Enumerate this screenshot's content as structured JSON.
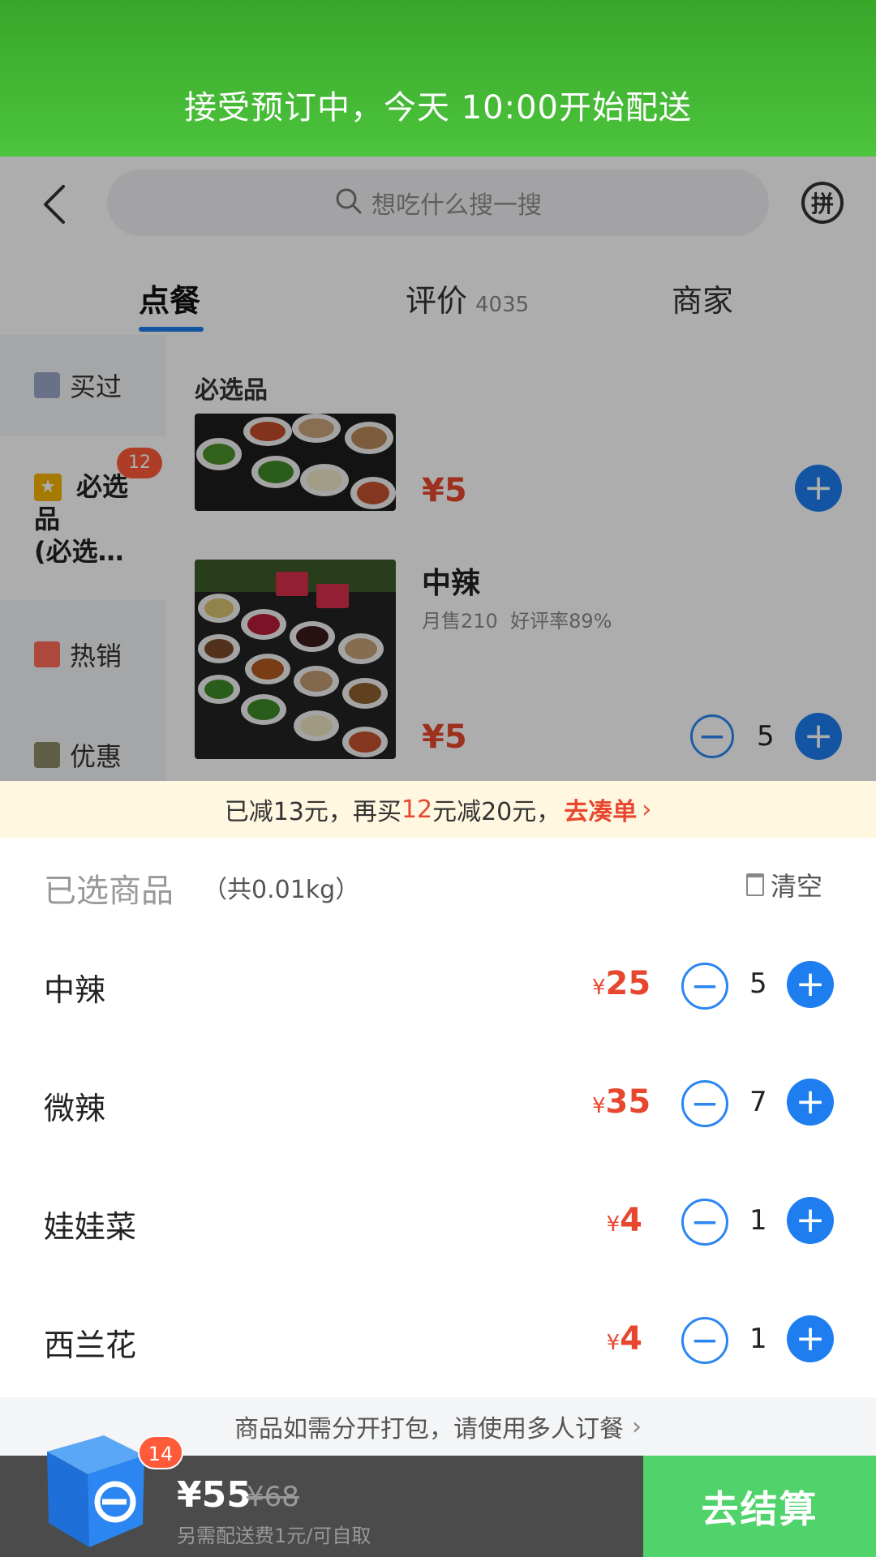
{
  "banner": {
    "text": "接受预订中，今天 10:00开始配送"
  },
  "header": {
    "search_placeholder": "想吃什么搜一搜",
    "group_icon": "拼"
  },
  "tabs": [
    {
      "label": "点餐",
      "active": true
    },
    {
      "label": "评价",
      "count": "4035"
    },
    {
      "label": "商家"
    }
  ],
  "sidebar": {
    "items": [
      {
        "label": "买过"
      },
      {
        "label": "必选品(必选…",
        "line1": "必选",
        "line2": "品",
        "line3": "(必选…",
        "badge": "12"
      },
      {
        "label": "热销"
      },
      {
        "label": "优惠"
      }
    ]
  },
  "menu": {
    "section_title": "必选品",
    "item1": {
      "price": "¥5"
    },
    "item2": {
      "name": "中辣",
      "sales": "月售210",
      "rating": "好评率89%",
      "price": "¥5",
      "qty": "5"
    }
  },
  "promo": {
    "prefix": "已减13元，再买",
    "amount": "12",
    "suffix": "元减20元，",
    "link": "去凑单",
    "chevron": "›"
  },
  "sheet": {
    "title": "已选商品",
    "weight": "（共0.01kg）",
    "clear_label": "清空",
    "rows": [
      {
        "name": "中辣",
        "yen": "¥",
        "price": "25",
        "qty": "5"
      },
      {
        "name": "微辣",
        "yen": "¥",
        "price": "35",
        "qty": "7"
      },
      {
        "name": "娃娃菜",
        "yen": "¥",
        "price": "4",
        "qty": "1"
      },
      {
        "name": "西兰花",
        "yen": "¥",
        "price": "4",
        "qty": "1"
      }
    ]
  },
  "tip": {
    "text": "商品如需分开打包，请使用多人订餐",
    "chevron": "›"
  },
  "bottom": {
    "total": "¥55",
    "original": "¥68",
    "fee_note": "另需配送费1元/可自取",
    "cart_count": "14",
    "checkout_label": "去结算"
  },
  "colors": {
    "accent": "#1e7ef0",
    "price": "#e8472f",
    "checkout": "#4fd36a",
    "banner": "#44b834"
  }
}
